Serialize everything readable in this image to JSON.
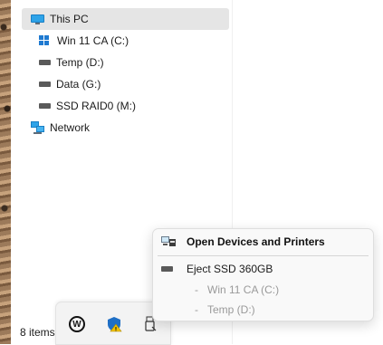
{
  "nav_tree": {
    "this_pc": "This PC",
    "drives": [
      "Win 11 CA (C:)",
      "Temp (D:)",
      "Data (G:)",
      "SSD RAID0 (M:)"
    ],
    "network": "Network"
  },
  "status_bar": {
    "item_count": "8 items"
  },
  "tray": {
    "icons": [
      "w-app-icon",
      "shield-warning-icon",
      "usb-drive-icon"
    ]
  },
  "context_menu": {
    "open_devices": "Open Devices and Printers",
    "eject": "Eject SSD 360GB",
    "dash": "-",
    "volumes": [
      "Win 11 CA (C:)",
      "Temp (D:)"
    ]
  },
  "colors": {
    "selection": "#e5e5e5",
    "disabled_text": "#9a9a9a",
    "menu_bg": "#f9f9f9"
  }
}
